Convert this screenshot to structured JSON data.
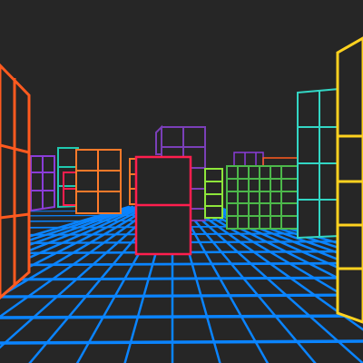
{
  "scene": {
    "background": "#262626",
    "palette": {
      "floor_grid": "#0a84ff",
      "orange": "#ff5a1f",
      "orange_light": "#ff7a2a",
      "yellow": "#ffd21f",
      "teal": "#20c9b0",
      "crimson": "#ff1e4e",
      "purple": "#8a3cd8",
      "lime": "#8ee63a",
      "violet": "#7a3fb8",
      "green": "#4cb84a",
      "aqua": "#33d6c4"
    },
    "objects": [
      {
        "kind": "floor-grid",
        "color": "floor_grid"
      },
      {
        "kind": "wireframe-building",
        "id": "left-wall-building",
        "color": "orange"
      },
      {
        "kind": "wireframe-building",
        "id": "far-left-purple-building",
        "color": "purple"
      },
      {
        "kind": "wireframe-building",
        "id": "far-left-teal-building",
        "color": "teal"
      },
      {
        "kind": "wireframe-building",
        "id": "center-left-orange-building",
        "color": "orange_light"
      },
      {
        "kind": "wireframe-building",
        "id": "center-purple-building",
        "color": "violet"
      },
      {
        "kind": "wireframe-building",
        "id": "center-crimson-building",
        "color": "crimson"
      },
      {
        "kind": "wireframe-building",
        "id": "lime-building",
        "color": "lime"
      },
      {
        "kind": "wireframe-building",
        "id": "green-building",
        "color": "green"
      },
      {
        "kind": "wireframe-building",
        "id": "right-teal-building",
        "color": "aqua"
      },
      {
        "kind": "wireframe-building",
        "id": "right-yellow-building",
        "color": "yellow"
      }
    ]
  }
}
